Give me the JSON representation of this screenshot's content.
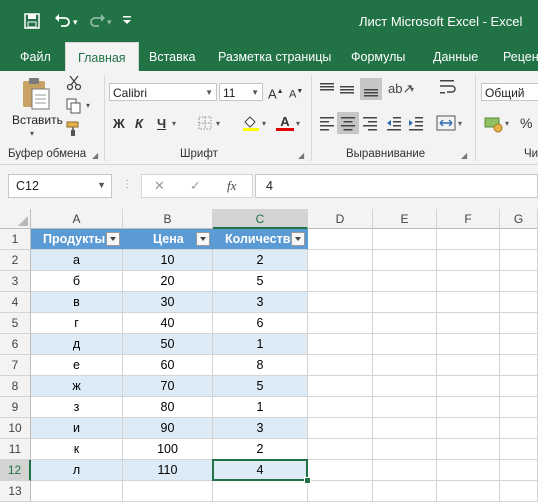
{
  "window": {
    "title": "Лист Microsoft Excel  -  Excel"
  },
  "qat": {
    "save_icon": "save-icon",
    "undo_icon": "undo-icon",
    "redo_icon": "redo-icon",
    "customize_icon": "chevron-down-icon"
  },
  "tabs": [
    {
      "label": "Файл"
    },
    {
      "label": "Главная",
      "active": true
    },
    {
      "label": "Вставка"
    },
    {
      "label": "Разметка страницы"
    },
    {
      "label": "Формулы"
    },
    {
      "label": "Данные"
    },
    {
      "label": "Реценз"
    }
  ],
  "ribbon": {
    "clipboard": {
      "paste_label": "Вставить",
      "group_label": "Буфер обмена"
    },
    "font": {
      "name": "Calibri",
      "size": "11",
      "bold": "Ж",
      "italic": "К",
      "underline": "Ч",
      "group_label": "Шрифт"
    },
    "alignment": {
      "group_label": "Выравнивание"
    },
    "number": {
      "format": "Общий",
      "percent": "%",
      "group_label": "Чи"
    }
  },
  "formula_bar": {
    "name_box": "C12",
    "cancel": "✕",
    "enter": "✓",
    "fx": "fx",
    "value": "4"
  },
  "columns": [
    "A",
    "B",
    "C",
    "D",
    "E",
    "F",
    "G"
  ],
  "rows": [
    "1",
    "2",
    "3",
    "4",
    "5",
    "6",
    "7",
    "8",
    "9",
    "10",
    "11",
    "12",
    "13"
  ],
  "table": {
    "headers": [
      "Продукты",
      "Цена",
      "Количество"
    ],
    "data": [
      [
        "а",
        "10",
        "2"
      ],
      [
        "б",
        "20",
        "5"
      ],
      [
        "в",
        "30",
        "3"
      ],
      [
        "г",
        "40",
        "6"
      ],
      [
        "д",
        "50",
        "1"
      ],
      [
        "е",
        "60",
        "8"
      ],
      [
        "ж",
        "70",
        "5"
      ],
      [
        "з",
        "80",
        "1"
      ],
      [
        "и",
        "90",
        "3"
      ],
      [
        "к",
        "100",
        "2"
      ],
      [
        "л",
        "110",
        "4"
      ]
    ]
  },
  "selection": {
    "cell": "C12"
  },
  "colors": {
    "accent": "#217346",
    "table_header": "#5b9bd5",
    "band": "#ddebf7"
  }
}
